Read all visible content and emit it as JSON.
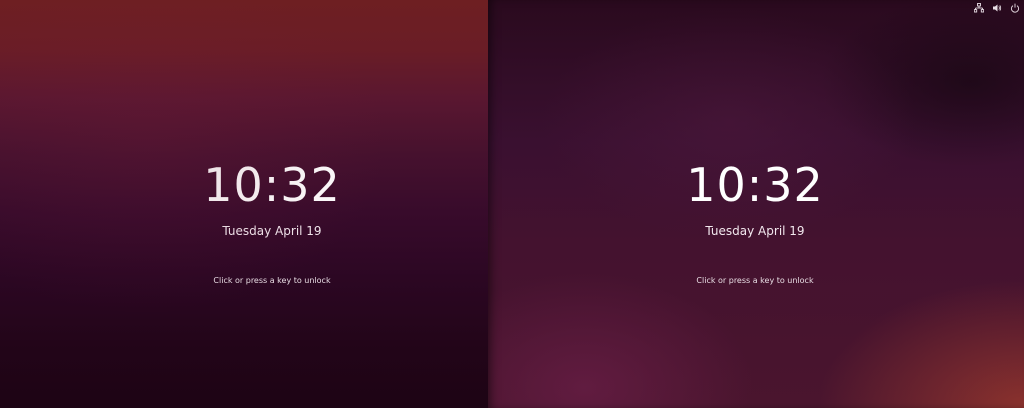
{
  "screens": [
    {
      "time": "10:32",
      "date": "Tuesday April 19",
      "unlock_hint": "Click or press a key to unlock"
    },
    {
      "time": "10:32",
      "date": "Tuesday April 19",
      "unlock_hint": "Click or press a key to unlock"
    }
  ],
  "system_tray": {
    "icons": [
      "network-wired-icon",
      "volume-icon",
      "power-icon"
    ]
  },
  "colors": {
    "text": "#ffffff",
    "left_bg_top": "#6e1f22",
    "left_bg_bottom": "#1d0414",
    "right_bg_base": "#3a1030",
    "right_accent_corner": "#963729"
  }
}
